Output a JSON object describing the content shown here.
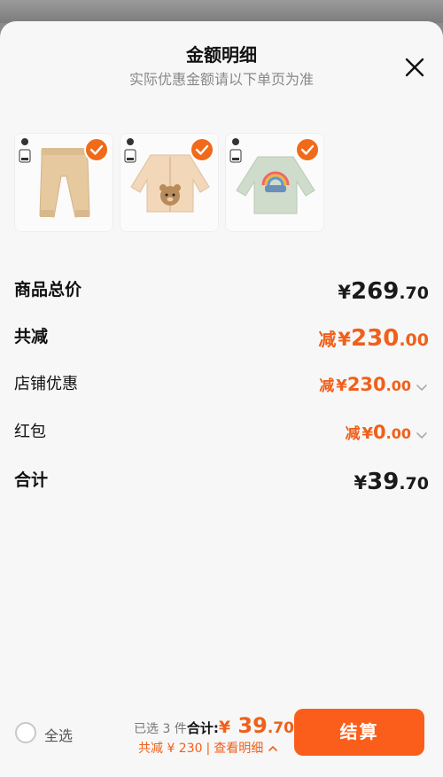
{
  "header": {
    "title": "金额明细",
    "subtitle": "实际优惠金额请以下单页为准"
  },
  "products": [
    {
      "name": "beige-pants"
    },
    {
      "name": "bear-cardigan"
    },
    {
      "name": "rainbow-tshirt"
    }
  ],
  "summary": {
    "total": {
      "label": "商品总价",
      "currency": "¥",
      "int": "269",
      "dec": ".70"
    },
    "discount": {
      "label": "共减",
      "prefix": "减",
      "currency": "¥",
      "int": "230",
      "dec": ".00"
    },
    "store": {
      "label": "店铺优惠",
      "prefix": "减",
      "currency": "¥",
      "int": "230",
      "dec": ".00"
    },
    "redpacket": {
      "label": "红包",
      "prefix": "减",
      "currency": "¥",
      "int": "0",
      "dec": ".00"
    },
    "sum": {
      "label": "合计",
      "currency": "¥",
      "int": "39",
      "dec": ".70"
    }
  },
  "footer": {
    "select_all": "全选",
    "selected_count": "已选 3 件",
    "total_label": "合计:",
    "currency": "¥",
    "total_int": " 39",
    "total_dec": ".70",
    "discount_text": "共减 ¥ 230",
    "separator": "|",
    "view_detail": "查看明细",
    "pay_button": "结算"
  },
  "colors": {
    "accent": "#f0601a",
    "button": "#fa5e1a",
    "background": "#f7f7f7"
  }
}
